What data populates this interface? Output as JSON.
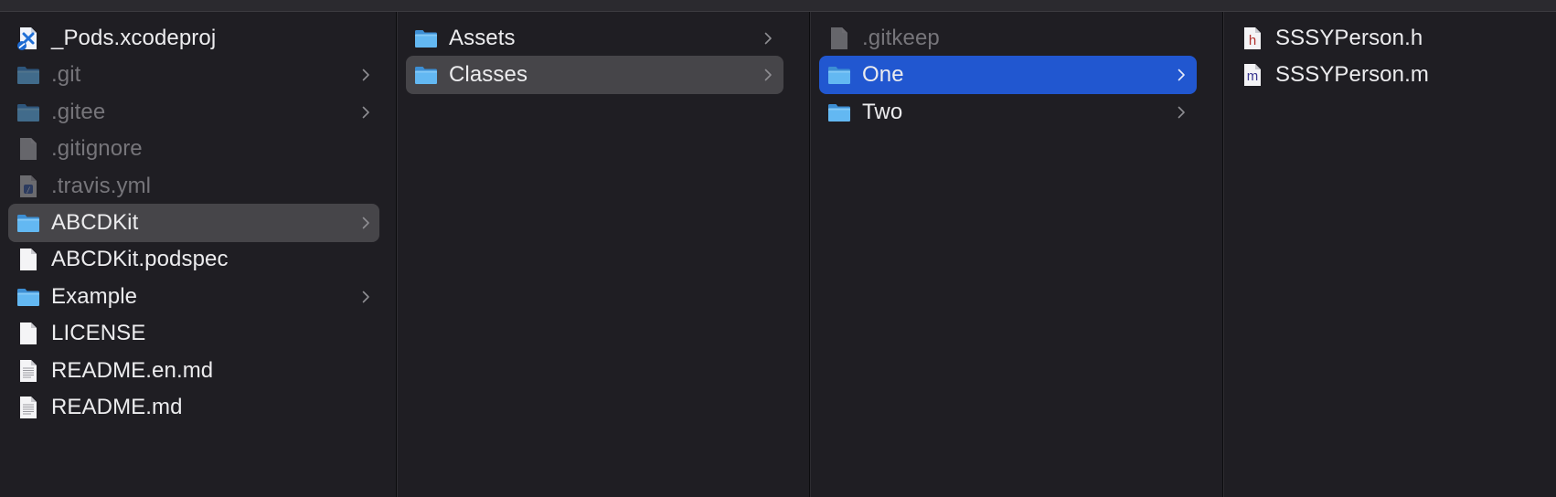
{
  "columns": [
    {
      "items": [
        {
          "label": "_Pods.xcodeproj",
          "icon": "xcodeproj-icon",
          "dim": false,
          "folder": false,
          "selected": null
        },
        {
          "label": ".git",
          "icon": "folder-icon",
          "dim": true,
          "folder": true,
          "selected": null
        },
        {
          "label": ".gitee",
          "icon": "folder-icon",
          "dim": true,
          "folder": true,
          "selected": null
        },
        {
          "label": ".gitignore",
          "icon": "document-icon",
          "dim": true,
          "folder": false,
          "selected": null
        },
        {
          "label": ".travis.yml",
          "icon": "yaml-file-icon",
          "dim": true,
          "folder": false,
          "selected": null
        },
        {
          "label": "ABCDKit",
          "icon": "folder-icon",
          "dim": false,
          "folder": true,
          "selected": "gray"
        },
        {
          "label": "ABCDKit.podspec",
          "icon": "document-icon",
          "dim": false,
          "folder": false,
          "selected": null
        },
        {
          "label": "Example",
          "icon": "folder-icon",
          "dim": false,
          "folder": true,
          "selected": null
        },
        {
          "label": "LICENSE",
          "icon": "document-icon",
          "dim": false,
          "folder": false,
          "selected": null
        },
        {
          "label": "README.en.md",
          "icon": "text-file-icon",
          "dim": false,
          "folder": false,
          "selected": null
        },
        {
          "label": "README.md",
          "icon": "text-file-icon",
          "dim": false,
          "folder": false,
          "selected": null
        }
      ]
    },
    {
      "items": [
        {
          "label": "Assets",
          "icon": "folder-icon",
          "dim": false,
          "folder": true,
          "selected": null
        },
        {
          "label": "Classes",
          "icon": "folder-icon",
          "dim": false,
          "folder": true,
          "selected": "gray"
        }
      ]
    },
    {
      "items": [
        {
          "label": ".gitkeep",
          "icon": "document-icon",
          "dim": true,
          "folder": false,
          "selected": null
        },
        {
          "label": "One",
          "icon": "folder-icon",
          "dim": false,
          "folder": true,
          "selected": "blue"
        },
        {
          "label": "Two",
          "icon": "folder-icon",
          "dim": false,
          "folder": true,
          "selected": null
        }
      ]
    },
    {
      "items": [
        {
          "label": "SSSYPerson.h",
          "icon": "header-file-icon",
          "dim": false,
          "folder": false,
          "selected": null
        },
        {
          "label": "SSSYPerson.m",
          "icon": "objc-file-icon",
          "dim": false,
          "folder": false,
          "selected": null
        }
      ]
    }
  ],
  "colors": {
    "background": "#1f1e23",
    "selection_gray": "#464549",
    "selection_blue": "#2157d0",
    "text": "#ececee",
    "text_dim": "#76757a",
    "folder_blue": "#5ab4f0"
  }
}
